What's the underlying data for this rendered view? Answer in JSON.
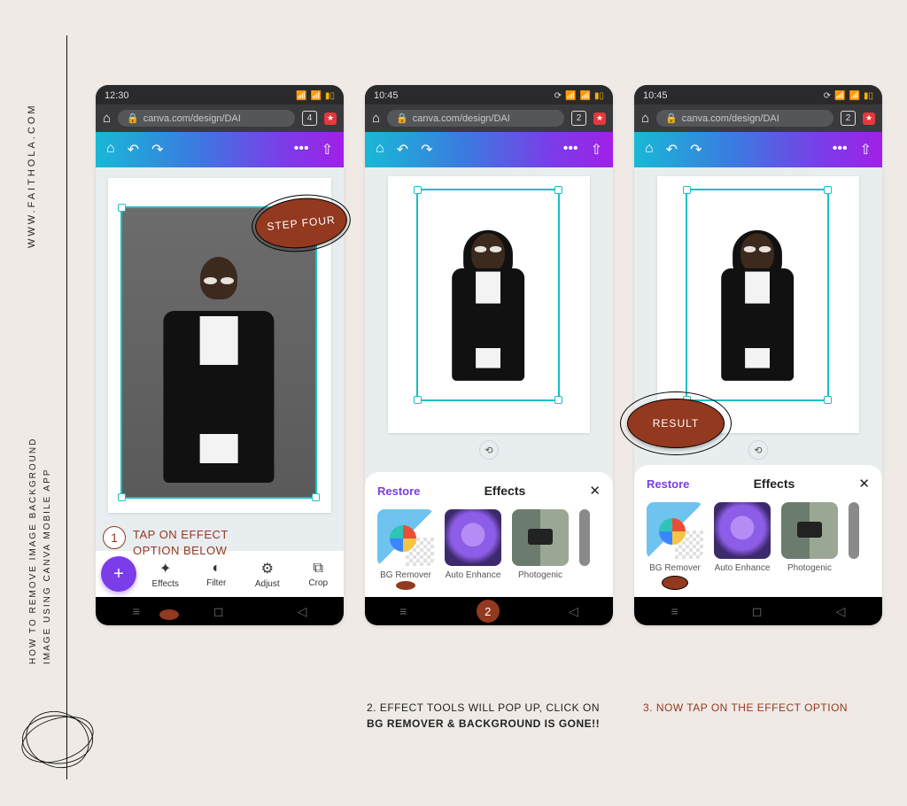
{
  "sidebar": {
    "url": "WWW.FAITHOLA.COM",
    "desc_line1": "HOW  TO  REMOVE   IMAGE  BACKGROUND",
    "desc_line2": "IMAGE USING CANVA MOBILE  APP"
  },
  "callouts": {
    "step4": "STEP FOUR",
    "result": "RESULT",
    "circle1": "1",
    "tap_line1": "TAP ON EFFECT",
    "tap_line2": "OPTION BELOW",
    "circle2": "2"
  },
  "captions": {
    "c2_lead": "2. EFFECT TOOLS WILL POP UP, CLICK ON",
    "c2_bold": "BG REMOVER & BACKGROUND IS GONE!!",
    "c3": "3. NOW TAP ON THE EFFECT OPTION"
  },
  "browser": {
    "url_text": "canva.com/design/DAI"
  },
  "phone1": {
    "time": "12:30",
    "tabcount": "4",
    "toolbar": {
      "effects": "Effects",
      "filter": "Filter",
      "adjust": "Adjust",
      "crop": "Crop"
    }
  },
  "phone2": {
    "time": "10:45",
    "tabcount": "2"
  },
  "phone3": {
    "time": "10:45",
    "tabcount": "2"
  },
  "effects": {
    "restore": "Restore",
    "title": "Effects",
    "bgremover": "BG Remover",
    "autoenhance": "Auto Enhance",
    "photogenic": "Photogenic"
  }
}
